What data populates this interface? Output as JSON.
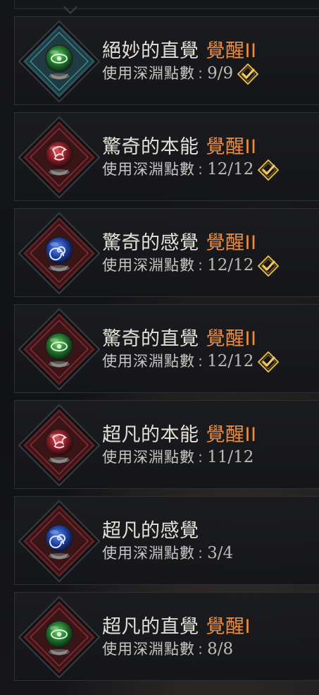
{
  "points_label": "使用深淵點數",
  "points_separator": ":",
  "colors": {
    "awaken_text": "#ee8d3c",
    "check_gold": "#e0b64a",
    "frame_teal": "#3f8a99",
    "frame_red": "#8a2f34"
  },
  "skills": [
    {
      "name": "絕妙的直覺",
      "awaken": "覺醒II",
      "points": "9/9",
      "completed": true,
      "frame": "teal",
      "orb": "green",
      "rune": "eye-icon"
    },
    {
      "name": "驚奇的本能",
      "awaken": "覺醒II",
      "points": "12/12",
      "completed": true,
      "frame": "red",
      "orb": "red",
      "rune": "claw-icon"
    },
    {
      "name": "驚奇的感覺",
      "awaken": "覺醒II",
      "points": "12/12",
      "completed": true,
      "frame": "red",
      "orb": "blue",
      "rune": "spiral-icon"
    },
    {
      "name": "驚奇的直覺",
      "awaken": "覺醒II",
      "points": "12/12",
      "completed": true,
      "frame": "red",
      "orb": "green",
      "rune": "eye-icon"
    },
    {
      "name": "超凡的本能",
      "awaken": "覺醒II",
      "points": "11/12",
      "completed": false,
      "frame": "red",
      "orb": "red",
      "rune": "claw-icon"
    },
    {
      "name": "超凡的感覺",
      "awaken": "",
      "points": "3/4",
      "completed": false,
      "frame": "red",
      "orb": "blue",
      "rune": "spiral-icon"
    },
    {
      "name": "超凡的直覺",
      "awaken": "覺醒I",
      "points": "8/8",
      "completed": false,
      "frame": "red",
      "orb": "green",
      "rune": "eye-icon"
    }
  ]
}
